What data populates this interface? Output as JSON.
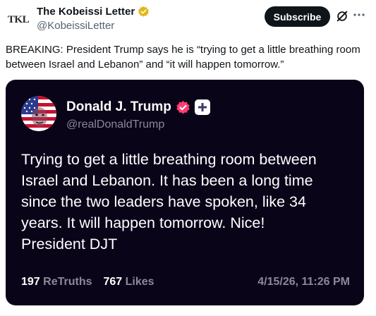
{
  "author": {
    "avatar_text": "TKL",
    "name": "The Kobeissi Letter",
    "handle": "@KobeissiLetter"
  },
  "actions": {
    "subscribe_label": "Subscribe",
    "grok_icon": "grok-icon",
    "more_icon": "more-icon"
  },
  "tweet": {
    "text": "BREAKING: President Trump says he is “trying to get a little breathing room between Israel and Lebanon” and “it will happen tomorrow.”"
  },
  "truth": {
    "name": "Donald J. Trump",
    "handle": "@realDonaldTrump",
    "body_lines": [
      "Trying to get a little breathing room between",
      "Israel and Lebanon. It has been a long time",
      "since the two leaders have spoken, like 34",
      "years. It will happen tomorrow. Nice!",
      "President DJT"
    ],
    "retruths_count": "197",
    "retruths_label": "ReTruths",
    "likes_count": "767",
    "likes_label": "Likes",
    "date": "4/15/26, 11:26 PM"
  },
  "colors": {
    "verified_gold": "#e2b719",
    "truth_bg": "#0a0419",
    "truth_verified": "#ff3d6e"
  }
}
